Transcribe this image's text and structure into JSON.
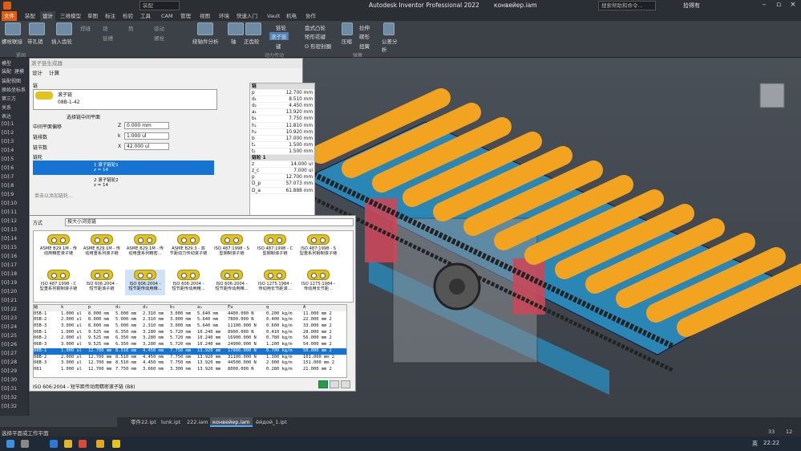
{
  "app": {
    "title": "Autodesk Inventor Professional 2022",
    "file": "конвейер.iam",
    "search_placeholder": "搜索帮助和命令...",
    "user": "拾得有",
    "qat_field": "装配"
  },
  "menu": {
    "tabs": [
      "文件",
      "装配",
      "设计",
      "三维模型",
      "草图",
      "标注",
      "检验",
      "工具",
      "CAM",
      "管理",
      "视图",
      "环境",
      "快速入门",
      "Vault",
      "机电",
      "协作"
    ]
  },
  "ribbon": {
    "items": [
      "螺栓联接",
      "带孔销",
      "插入齿轮",
      "焊缝",
      "销",
      "链槽",
      "筒",
      "驱动",
      "螺栓",
      "轴",
      "正齿轮",
      "链轮",
      "滚子链",
      "键",
      "盘式凸轮",
      "矩形花键",
      "O 形密封圈",
      "压缩",
      "拉伸",
      "碟形",
      "扭簧",
      "公差分析",
      "绕轴件分析"
    ],
    "groups": [
      "紧固",
      "动力传动",
      "弹簧",
      "公差分析"
    ]
  },
  "browser": {
    "header": "模型",
    "tabs": [
      "装配",
      "建模"
    ],
    "rows": [
      "装配视图",
      "原始坐标系",
      "第三方",
      "关系",
      "表达",
      "[O]:1",
      "[O]:2",
      "[O]:3",
      "[O]:4",
      "[O]:5",
      "[O]:6",
      "[O]:7",
      "[O]:8",
      "[O]:9",
      "[O]:10",
      "[O]:11",
      "[O]:12",
      "[O]:13",
      "[O]:14",
      "[O]:15",
      "[O]:16",
      "[O]:17",
      "[O]:18",
      "[O]:19",
      "[O]:20",
      "[O]:21",
      "[O]:22",
      "[O]:23",
      "[O]:24",
      "[O]:25",
      "[O]:26",
      "[O]:27",
      "[O]:28",
      "[O]:29",
      "[O]:30",
      "[O]:31",
      "[O]:32",
      "[O]:32"
    ]
  },
  "dialog": {
    "title": "滚子链生成器",
    "tab_design": "设计",
    "tab_calc": "计算",
    "chain_label": "链",
    "chain_name": "滚子链",
    "chain_code": "08B-1-42",
    "select_plane": "选择链中间平面",
    "offset_label": "中间平面偏移",
    "offset_sym": "Z",
    "offset_val": "0.000 mm",
    "rows_label": "链排数",
    "rows_sym": "k",
    "rows_val": "1.000 ul",
    "links_label": "链节数",
    "links_sym": "X",
    "links_val": "42.000 ul",
    "sprocket_label": "链轮",
    "sprocket1": "1  滚子链轮1",
    "sprocket1b": "z = 14",
    "sprocket2": "2  滚子链轮2",
    "sprocket2b": "z = 14",
    "add_hint": "单击以添加链轮...",
    "params_header": "链",
    "params": [
      [
        "p",
        "12.700 mm"
      ],
      [
        "d₁",
        "8.510 mm"
      ],
      [
        "d₂",
        "4.450 mm"
      ],
      [
        "a₁",
        "13.920 mm"
      ],
      [
        "b₁",
        "7.750 mm"
      ],
      [
        "h₁",
        "11.810 mm"
      ],
      [
        "h₂",
        "10.920 mm"
      ],
      [
        "b",
        "17.000 mm"
      ],
      [
        "t₁",
        "1.500 mm"
      ],
      [
        "t₂",
        "1.500 mm"
      ]
    ],
    "params2_header": "链轮 1",
    "params2": [
      [
        "z",
        "14.000 ul"
      ],
      [
        "z_c",
        "7.000 ul"
      ],
      [
        "p",
        "12.700 mm"
      ],
      [
        "D_p",
        "57.073 mm"
      ],
      [
        "D_a",
        "61.888 mm"
      ]
    ]
  },
  "catalog": {
    "method_label": "方式",
    "method_value": "按大小浏览链",
    "chains": [
      [
        "ASME B29.1M - 传",
        "动用精密滚子链"
      ],
      [
        "ASME B29.1M - 传",
        "动用重系列滚子链"
      ],
      [
        "ASME B29.1M - 传",
        "动用重系列精密..."
      ],
      [
        "ASME B29.3 - 双",
        "节距动力传动滚子链"
      ],
      [
        "ISO 487:1998 - S",
        "型钢制滚子链"
      ],
      [
        "ISO 487:1998 - C",
        "型钢制滚子链"
      ],
      [
        "ISO 487:1998 - S",
        "型重系列钢制滚子链"
      ],
      [
        "ISO 487:1998 - C",
        "型重系列钢制滚子链"
      ],
      [
        "ISO 606:2004 -",
        "短节距滚子链"
      ],
      [
        "ISO 606:2004 -",
        "短节距传动用精..."
      ],
      [
        "ISO 606:2004 -",
        "短节距传动用精..."
      ],
      [
        "ISO 606:2004 -",
        "短节距传动用精..."
      ],
      [
        "ISO 1275:1984 -",
        "传动用长节距滚..."
      ],
      [
        "ISO 1275:1984 -",
        "传动用长节距..."
      ]
    ],
    "columns": [
      "链",
      "k",
      "p",
      "d₁",
      "d₂",
      "b₁",
      "a₁",
      "Fu",
      "q",
      "A"
    ],
    "rows": [
      [
        "05B-1",
        "1.000 ul",
        "8.000 mm",
        "5.000 mm",
        "2.310 mm",
        "3.000 mm",
        "5.640 mm",
        "4400.000 N",
        "0.200 kg/m",
        "11.000 mm 2"
      ],
      [
        "05B-2",
        "2.000 ul",
        "8.000 mm",
        "5.000 mm",
        "2.310 mm",
        "3.000 mm",
        "5.640 mm",
        "7800.000 N",
        "0.400 kg/m",
        "22.000 mm 2"
      ],
      [
        "05B-3",
        "3.000 ul",
        "8.000 mm",
        "5.000 mm",
        "2.310 mm",
        "3.000 mm",
        "5.640 mm",
        "11100.000 N",
        "0.600 kg/m",
        "33.000 mm 2"
      ],
      [
        "06B-1",
        "1.000 ul",
        "9.525 mm",
        "6.350 mm",
        "3.280 mm",
        "5.720 mm",
        "10.240 mm",
        "8900.000 N",
        "0.410 kg/m",
        "28.000 mm 2"
      ],
      [
        "06B-2",
        "2.000 ul",
        "9.525 mm",
        "6.350 mm",
        "3.280 mm",
        "5.720 mm",
        "10.240 mm",
        "16900.000 N",
        "0.780 kg/m",
        "56.000 mm 2"
      ],
      [
        "06B-3",
        "3.000 ul",
        "9.525 mm",
        "6.350 mm",
        "3.280 mm",
        "5.720 mm",
        "10.240 mm",
        "24900.000 N",
        "1.200 kg/m",
        "54.000 mm 2"
      ],
      [
        "08B-1",
        "1.000 ul",
        "12.700 mm",
        "8.510 mm",
        "4.450 mm",
        "7.750 mm",
        "13.920 mm",
        "17800.000 N",
        "0.700 kg/m",
        "50.000 mm 2"
      ],
      [
        "08B-2",
        "2.000 ul",
        "12.700 mm",
        "8.510 mm",
        "4.450 mm",
        "7.750 mm",
        "13.920 mm",
        "31100.000 N",
        "1.300 kg/m",
        "101.000 mm 2"
      ],
      [
        "08B-3",
        "3.000 ul",
        "12.700 mm",
        "8.510 mm",
        "4.450 mm",
        "7.750 mm",
        "13.920 mm",
        "44500.000 N",
        "2.000 kg/m",
        "151.000 mm 2"
      ],
      [
        "081",
        "1.000 ul",
        "12.700 mm",
        "7.750 mm",
        "3.660 mm",
        "3.300 mm",
        "13.920 mm",
        "8000.000 N",
        "0.280 kg/m",
        "21.000 mm 2"
      ]
    ],
    "selected_row": 6,
    "footer": "ISO 606:2004 - 短节距传动用精密滚子链 (B8)"
  },
  "doctabs": [
    "零件22.ipt",
    "lunk.ipt",
    "222.iam",
    "конвейер.iam",
    "ёйдой_1.ipt"
  ],
  "status": {
    "left": "选择平面或工作平面",
    "n1": "33",
    "n2": "12"
  },
  "taskbar": {
    "ime": "英",
    "time": "22:22"
  }
}
